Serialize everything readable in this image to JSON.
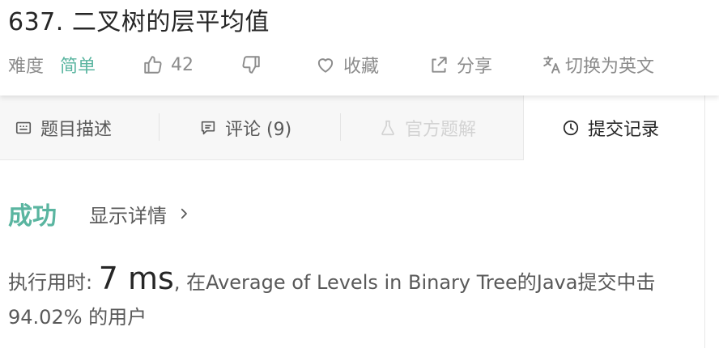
{
  "problem": {
    "title": "637. 二叉树的层平均值",
    "difficulty_label": "难度",
    "difficulty_value": "简单",
    "likes": "42",
    "favorite_label": "收藏",
    "share_label": "分享",
    "translate_label": "切换为英文"
  },
  "tabs": [
    {
      "label": "题目描述"
    },
    {
      "label": "评论 (9)"
    },
    {
      "label": "官方题解"
    },
    {
      "label": "提交记录"
    }
  ],
  "result": {
    "status": "成功",
    "details_label": "显示详情",
    "runtime_prefix": "执行用时:",
    "runtime_value": "7 ms",
    "runtime_suffix": ", 在Average of Levels in Binary Tree的Java提交中击",
    "percent_line": "94.02% 的用户"
  },
  "colors": {
    "accent": "#5ab5a0",
    "text": "#262626",
    "muted": "#8c8c8c"
  }
}
